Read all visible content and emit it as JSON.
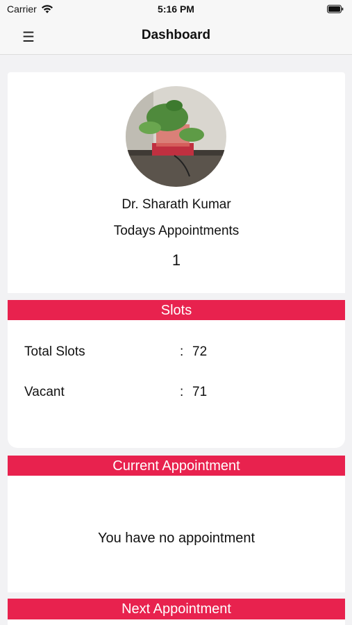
{
  "status_bar": {
    "carrier": "Carrier",
    "time": "5:16 PM"
  },
  "nav": {
    "title": "Dashboard",
    "menu_icon": "hamburger-menu-icon"
  },
  "profile": {
    "doctor_name": "Dr. Sharath Kumar",
    "appointments_label": "Todays Appointments",
    "appointments_count": "1"
  },
  "slots": {
    "header": "Slots",
    "rows": [
      {
        "label": "Total Slots",
        "colon": ":",
        "value": "72"
      },
      {
        "label": "Vacant",
        "colon": ":",
        "value": "71"
      }
    ]
  },
  "current_appointment": {
    "header": "Current Appointment",
    "message": "You have no appointment"
  },
  "next_appointment": {
    "header": "Next Appointment"
  },
  "colors": {
    "accent": "#e8224e",
    "background": "#f2f2f4",
    "card": "#ffffff"
  }
}
